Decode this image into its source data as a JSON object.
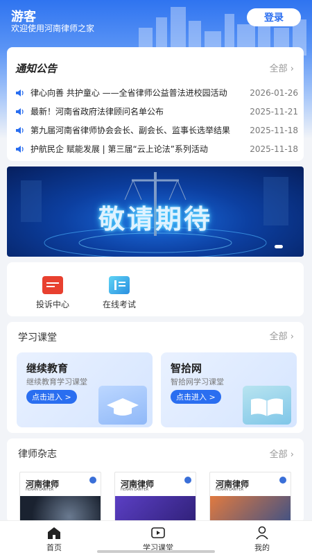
{
  "header": {
    "user": "游客",
    "welcome": "欢迎使用河南律师之家",
    "login_label": "登录"
  },
  "notice": {
    "title": "通知公告",
    "more_label": "全部",
    "items": [
      {
        "text": "律心向善 共护童心 ——全省律师公益普法进校园活动",
        "date": "2026-01-26"
      },
      {
        "text": "最新！河南省政府法律顾问名单公布",
        "date": "2025-11-21"
      },
      {
        "text": "第九届河南省律师协会会长、副会长、监事长选举结果",
        "date": "2025-11-18"
      },
      {
        "text": "护航民企 赋能发展 | 第三届“云上论法”系列活动",
        "date": "2025-11-18"
      }
    ]
  },
  "banner": {
    "text": "敬请期待"
  },
  "quick": {
    "items": [
      {
        "label": "投诉中心",
        "icon": "complaint-icon"
      },
      {
        "label": "在线考试",
        "icon": "exam-icon"
      }
    ]
  },
  "study": {
    "title": "学习课堂",
    "more_label": "全部",
    "cards": [
      {
        "title": "继续教育",
        "desc": "继续教育学习课堂",
        "button": "点击进入 >"
      },
      {
        "title": "智拾网",
        "desc": "智拾网学习课堂",
        "button": "点击进入 >"
      }
    ]
  },
  "magazine": {
    "title": "律师杂志",
    "more_label": "全部",
    "items": [
      {
        "title": "河南律师",
        "sub": "HENAN LAWYER"
      },
      {
        "title": "河南律师",
        "sub": "HENAN LAWYER"
      },
      {
        "title": "河南律师",
        "sub": "HENAN LAWYER"
      }
    ]
  },
  "nav": {
    "items": [
      {
        "label": "首页",
        "icon": "home-icon"
      },
      {
        "label": "学习课堂",
        "icon": "video-icon"
      },
      {
        "label": "我的",
        "icon": "user-icon"
      }
    ]
  },
  "colors": {
    "primary": "#2a6ef0",
    "banner_dark": "#061f5e",
    "complaint_red": "#e8402f",
    "exam_cyan": "#35b8e8"
  }
}
